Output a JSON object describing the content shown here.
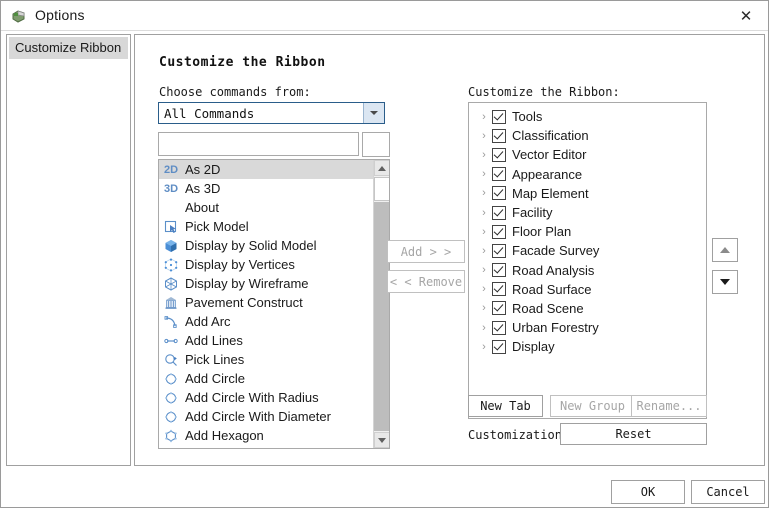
{
  "window": {
    "title": "Options",
    "icon": "app-icon",
    "close_label": "✕"
  },
  "sidebar": {
    "items": [
      {
        "label": "Customize Ribbon",
        "selected": true
      }
    ]
  },
  "main": {
    "heading": "Customize the Ribbon",
    "choose_commands_label": "Choose commands from:",
    "command_source": {
      "value": "All Commands",
      "options": [
        "All Commands"
      ]
    },
    "search": {
      "value": "",
      "placeholder": ""
    },
    "commands": [
      {
        "label": "As 2D",
        "icon": "text-2d-icon",
        "selected": true
      },
      {
        "label": "As 3D",
        "icon": "text-3d-icon",
        "selected": false
      },
      {
        "label": "About",
        "icon": "none",
        "selected": false
      },
      {
        "label": "Pick Model",
        "icon": "pick-model-icon",
        "selected": false
      },
      {
        "label": "Display by Solid Model",
        "icon": "solid-model-icon",
        "selected": false
      },
      {
        "label": "Display by Vertices",
        "icon": "vertices-icon",
        "selected": false
      },
      {
        "label": "Display by Wireframe",
        "icon": "wireframe-icon",
        "selected": false
      },
      {
        "label": "Pavement Construct",
        "icon": "pavement-icon",
        "selected": false
      },
      {
        "label": "Add Arc",
        "icon": "arc-icon",
        "selected": false
      },
      {
        "label": "Add Lines",
        "icon": "line-icon",
        "selected": false
      },
      {
        "label": "Pick Lines",
        "icon": "pick-lines-icon",
        "selected": false
      },
      {
        "label": "Add Circle",
        "icon": "circle-icon",
        "selected": false
      },
      {
        "label": "Add Circle With Radius",
        "icon": "circle-icon",
        "selected": false
      },
      {
        "label": "Add Circle With Diameter",
        "icon": "circle-icon",
        "selected": false
      },
      {
        "label": "Add Hexagon",
        "icon": "hexagon-icon",
        "selected": false
      }
    ],
    "transfer": {
      "add_label": "Add > >",
      "add_enabled": false,
      "remove_label": "< < Remove",
      "remove_enabled": false
    },
    "ribbon_label": "Customize the Ribbon:",
    "ribbon_tree": [
      {
        "label": "Tools",
        "checked": true,
        "expanded": false
      },
      {
        "label": "Classification",
        "checked": true,
        "expanded": false
      },
      {
        "label": "Vector Editor",
        "checked": true,
        "expanded": false
      },
      {
        "label": "Appearance",
        "checked": true,
        "expanded": false
      },
      {
        "label": "Map Element",
        "checked": true,
        "expanded": false
      },
      {
        "label": "Facility",
        "checked": true,
        "expanded": false
      },
      {
        "label": "Floor Plan",
        "checked": true,
        "expanded": false
      },
      {
        "label": "Facade Survey",
        "checked": true,
        "expanded": false
      },
      {
        "label": "Road Analysis",
        "checked": true,
        "expanded": false
      },
      {
        "label": "Road Surface",
        "checked": true,
        "expanded": false
      },
      {
        "label": "Road Scene",
        "checked": true,
        "expanded": false
      },
      {
        "label": "Urban Forestry",
        "checked": true,
        "expanded": false
      },
      {
        "label": "Display",
        "checked": true,
        "expanded": false
      }
    ],
    "move_up_enabled": false,
    "move_down_enabled": true,
    "new_tab_label": "New Tab",
    "new_group_label": "New Group",
    "rename_label": "Rename...",
    "customizations_label": "Customizations:",
    "reset_label": "Reset"
  },
  "footer": {
    "ok_label": "OK",
    "cancel_label": "Cancel"
  },
  "colors": {
    "accent": "#2a5d8a",
    "icon_blue": "#5b8fc9",
    "selection": "#d9d9d9",
    "tab_selected": "#d8d8d8"
  }
}
